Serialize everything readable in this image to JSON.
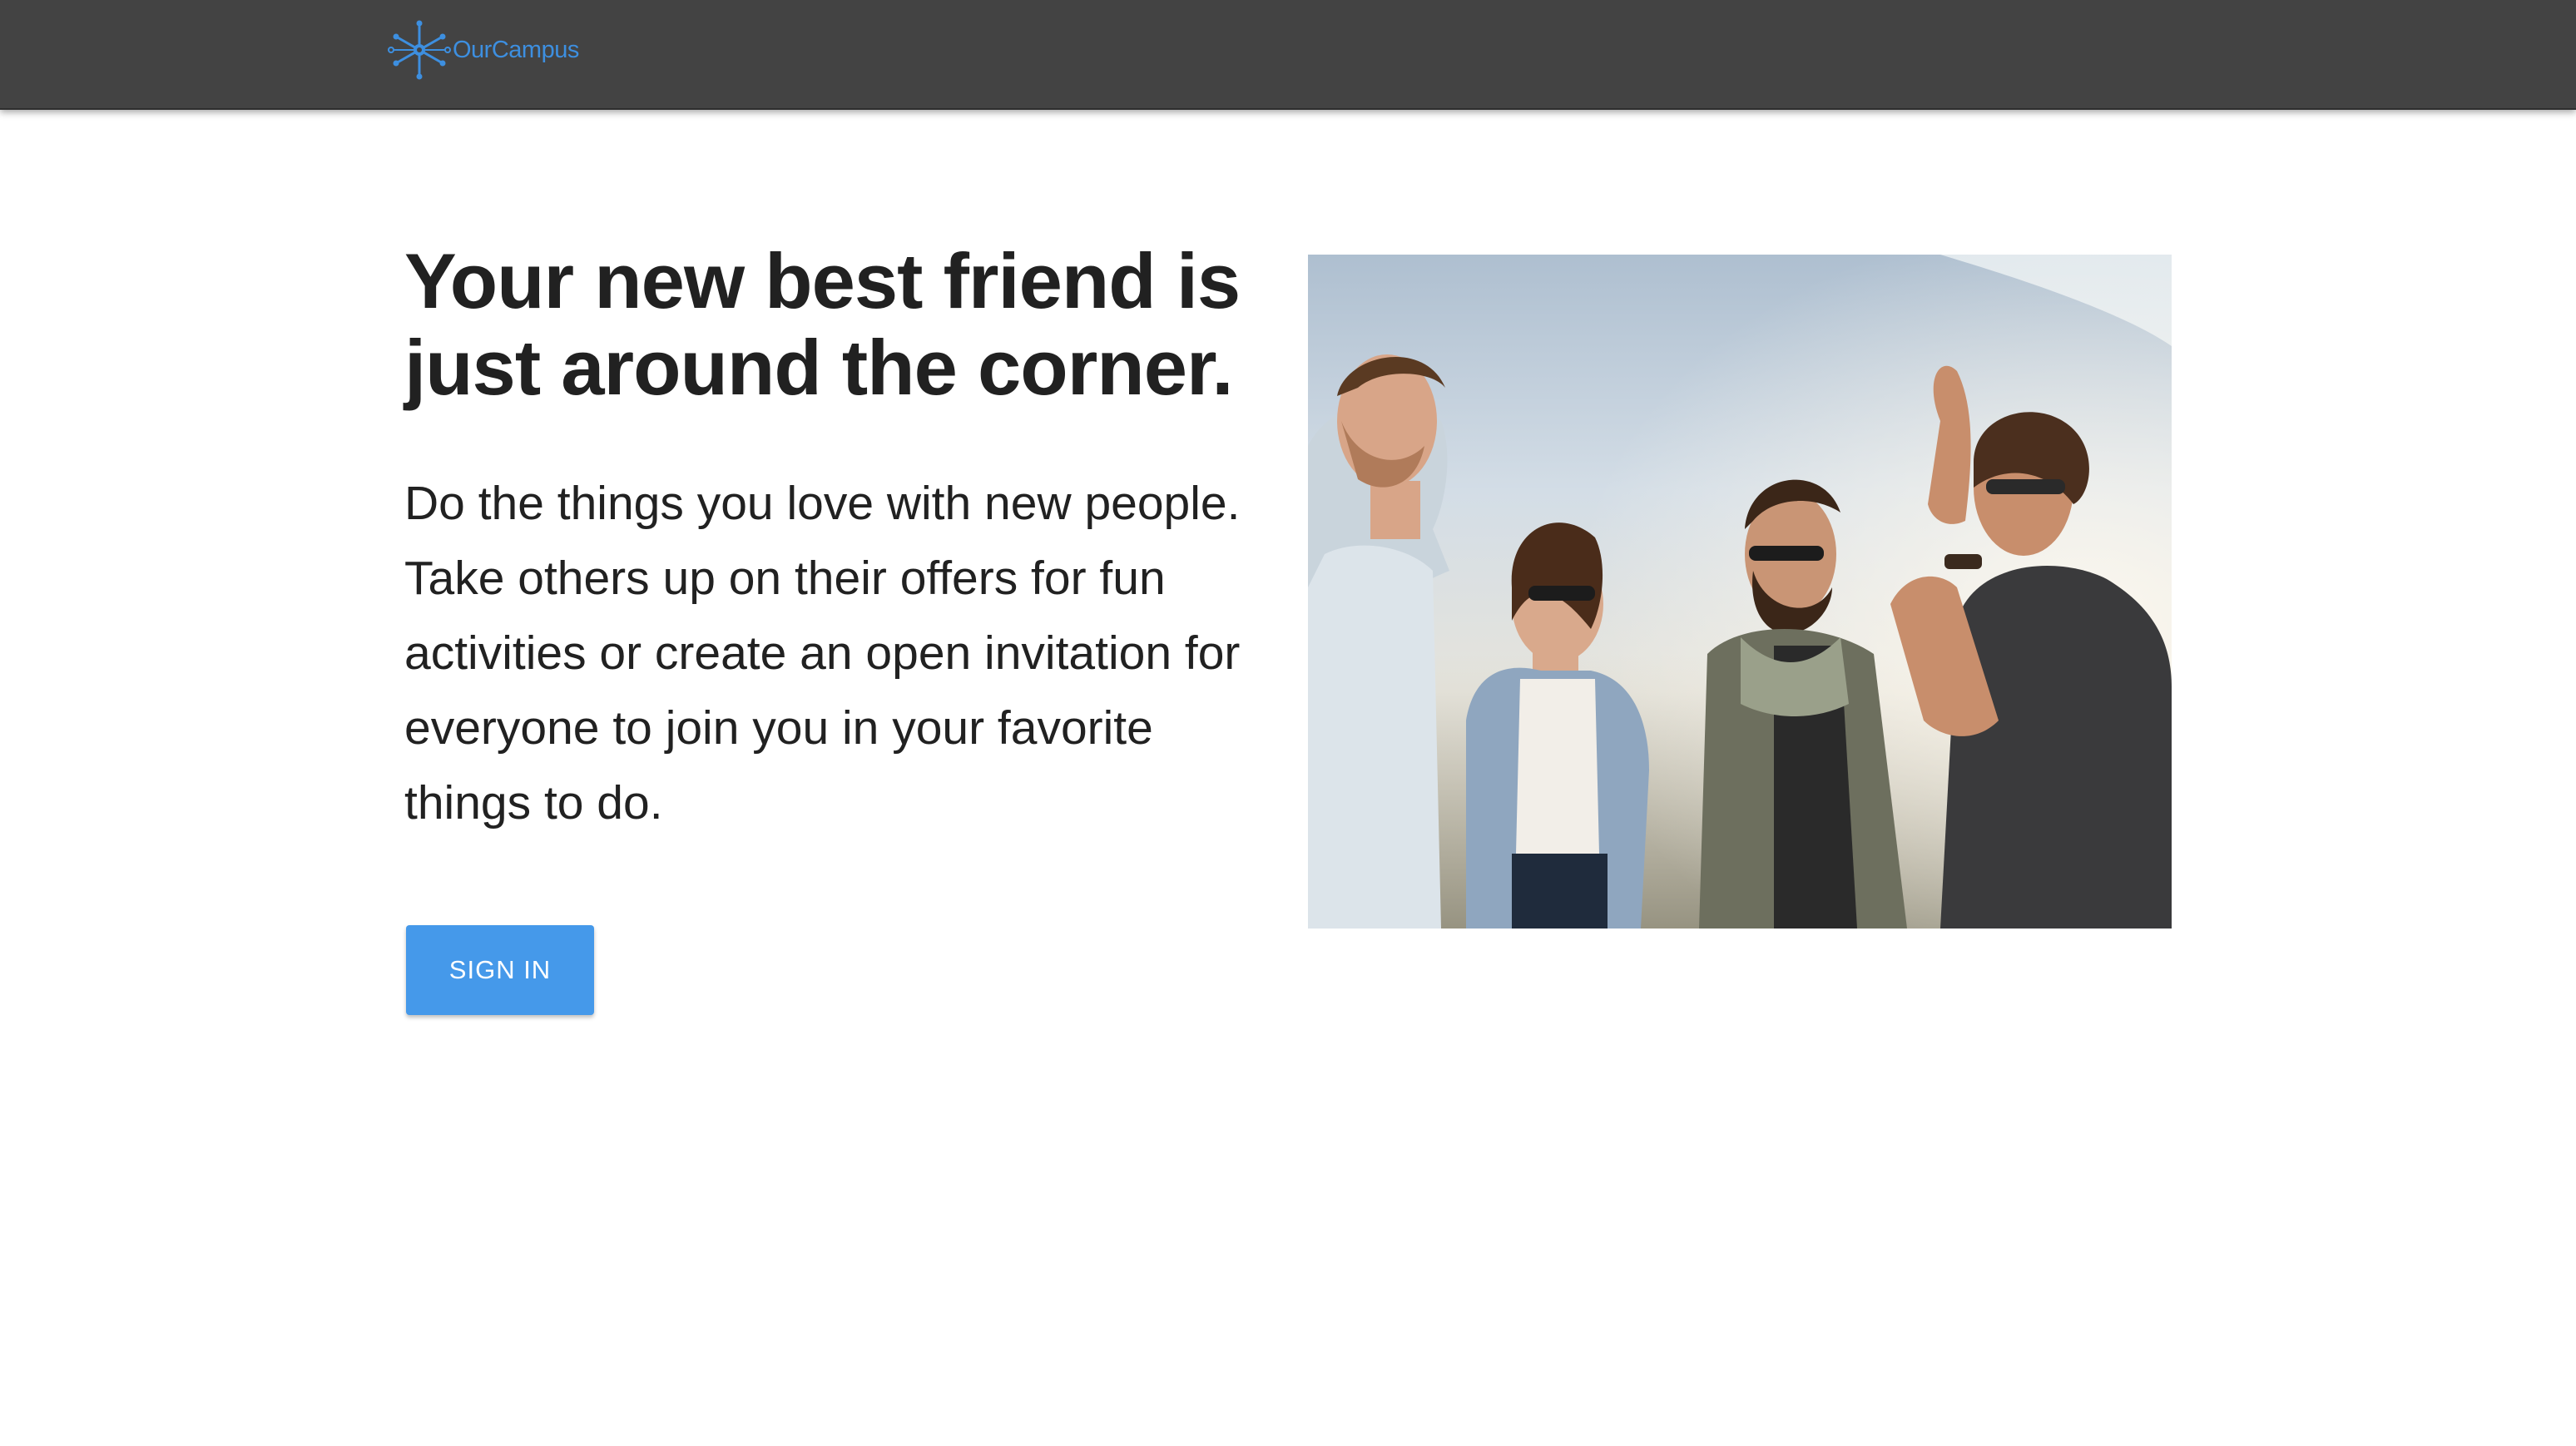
{
  "header": {
    "logo_text": "OurCampus",
    "logo_icon": "network-snowflake-icon"
  },
  "hero": {
    "headline": "Your new best friend is just around the corner.",
    "description": "Do the things you love with new people. Take others up on their offers for fun activities or create an open invitation for everyone to join you in your favorite things to do.",
    "sign_in_label": "SIGN IN",
    "photo_icon": "friends-group-photo"
  },
  "colors": {
    "app_bar": "#434343",
    "accent": "#4599ea",
    "logo": "#3d8fe0",
    "text": "#212121",
    "background": "#ffffff"
  }
}
